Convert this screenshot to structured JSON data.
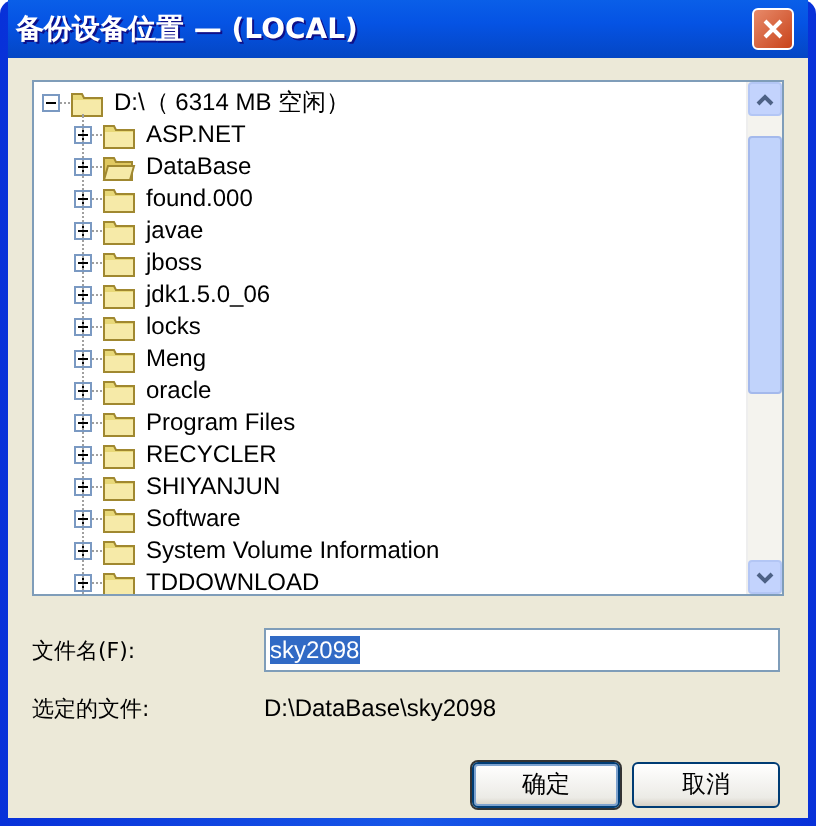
{
  "window": {
    "title": "备份设备位置 — (LOCAL)"
  },
  "tree": {
    "items": [
      {
        "label": "D:\\（ 6314 MB 空闲）",
        "expanded": true,
        "open": false,
        "children": [
          {
            "label": "ASP.NET",
            "expanded": false,
            "open": false
          },
          {
            "label": "DataBase",
            "expanded": false,
            "open": true
          },
          {
            "label": "found.000",
            "expanded": false,
            "open": false
          },
          {
            "label": "javae",
            "expanded": false,
            "open": false
          },
          {
            "label": "jboss",
            "expanded": false,
            "open": false
          },
          {
            "label": "jdk1.5.0_06",
            "expanded": false,
            "open": false
          },
          {
            "label": "locks",
            "expanded": false,
            "open": false
          },
          {
            "label": "Meng",
            "expanded": false,
            "open": false
          },
          {
            "label": "oracle",
            "expanded": false,
            "open": false
          },
          {
            "label": "Program Files",
            "expanded": false,
            "open": false
          },
          {
            "label": "RECYCLER",
            "expanded": false,
            "open": false
          },
          {
            "label": "SHIYANJUN",
            "expanded": false,
            "open": false
          },
          {
            "label": "Software",
            "expanded": false,
            "open": false
          },
          {
            "label": "System Volume Information",
            "expanded": false,
            "open": false
          },
          {
            "label": "TDDOWNLOAD",
            "expanded": false,
            "open": false
          }
        ]
      }
    ]
  },
  "file_name": {
    "label": "文件名(F):",
    "value": "sky2098",
    "selected": true
  },
  "selected_file": {
    "label": "选定的文件:",
    "value": "D:\\DataBase\\sky2098"
  },
  "buttons": [
    {
      "label": "确定",
      "default": true
    },
    {
      "label": "取消",
      "default": false
    }
  ]
}
